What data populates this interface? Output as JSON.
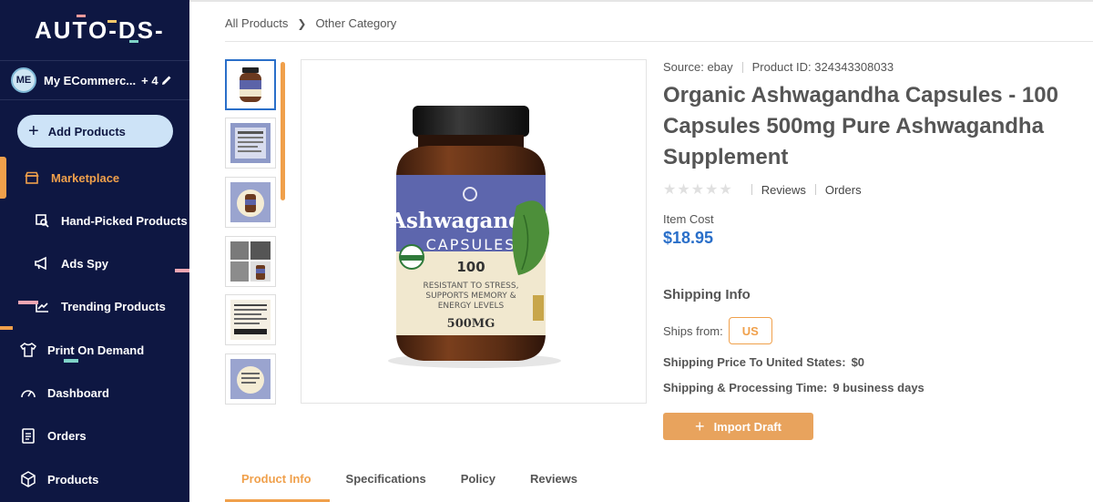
{
  "sidebar": {
    "logo": "AUTO-DS-",
    "store": {
      "avatar": "ME",
      "name": "My ECommerc...",
      "extra": "+ 4"
    },
    "add_products": "Add Products",
    "items": [
      {
        "label": "Marketplace",
        "icon": "store-icon",
        "active": true
      },
      {
        "label": "Hand-Picked Products",
        "icon": "hand-picked-icon"
      },
      {
        "label": "Ads Spy",
        "icon": "megaphone-icon"
      },
      {
        "label": "Trending Products",
        "icon": "trending-icon"
      },
      {
        "label": "Print On Demand",
        "icon": "shirt-icon"
      },
      {
        "label": "Dashboard",
        "icon": "gauge-icon"
      },
      {
        "label": "Orders",
        "icon": "orders-icon"
      },
      {
        "label": "Products",
        "icon": "box-icon"
      }
    ]
  },
  "breadcrumb": {
    "root": "All Products",
    "current": "Other Category"
  },
  "product": {
    "source_label": "Source:",
    "source": "ebay",
    "id_label": "Product ID:",
    "id": "324343308033",
    "title": "Organic Ashwagandha Capsules - 100 Capsules 500mg Pure Ashwagandha Supplement",
    "reviews": "Reviews",
    "orders": "Orders",
    "item_cost_label": "Item Cost",
    "item_cost": "$18.95",
    "bottle": {
      "brand": "Ashwagandha",
      "sub": "CAPSULES",
      "count": "100",
      "claims": "RESISTANT TO STRESS, SUPPORTS MEMORY & ENERGY LEVELS",
      "dose": "500MG",
      "badge": "USDA ORGANIC"
    }
  },
  "shipping": {
    "heading": "Shipping Info",
    "ships_from_label": "Ships from:",
    "ships_from": "US",
    "price_label": "Shipping Price To United States:",
    "price": "$0",
    "time_label": "Shipping & Processing Time:",
    "time": "9 business days"
  },
  "import_button": "Import Draft",
  "tabs": [
    "Product Info",
    "Specifications",
    "Policy",
    "Reviews"
  ],
  "colors": {
    "sidebar": "#0e1742",
    "accent": "#f0a04b",
    "price": "#2a6fc9"
  }
}
